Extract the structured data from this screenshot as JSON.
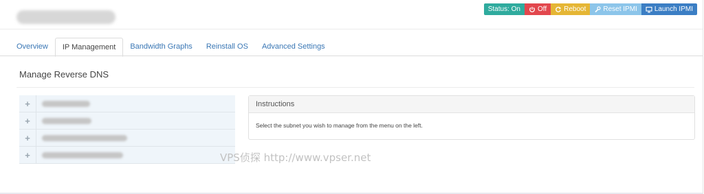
{
  "header": {
    "actions": {
      "status": "Status: On",
      "off": "Off",
      "reboot": "Reboot",
      "reset_ipmi": "Reset IPMI",
      "launch_ipmi": "Launch IPMI"
    }
  },
  "tabs": [
    {
      "label": "Overview"
    },
    {
      "label": "IP Management"
    },
    {
      "label": "Bandwidth Graphs"
    },
    {
      "label": "Reinstall OS"
    },
    {
      "label": "Advanced Settings"
    }
  ],
  "active_tab": "IP Management",
  "section": {
    "title": "Manage Reverse DNS"
  },
  "subnets": [
    {
      "expand": "+"
    },
    {
      "expand": "+"
    },
    {
      "expand": "+"
    },
    {
      "expand": "+"
    }
  ],
  "instructions": {
    "title": "Instructions",
    "body": "Select the subnet you wish to manage from the menu on the left."
  },
  "watermark": "VPS侦探 http://www.vpser.net",
  "colors": {
    "status": "#2fab9e",
    "off": "#e2474d",
    "reboot": "#e5b635",
    "reset_ipmi": "#8cc5ea",
    "launch_ipmi": "#3b7ec4",
    "link": "#3a77b5"
  }
}
